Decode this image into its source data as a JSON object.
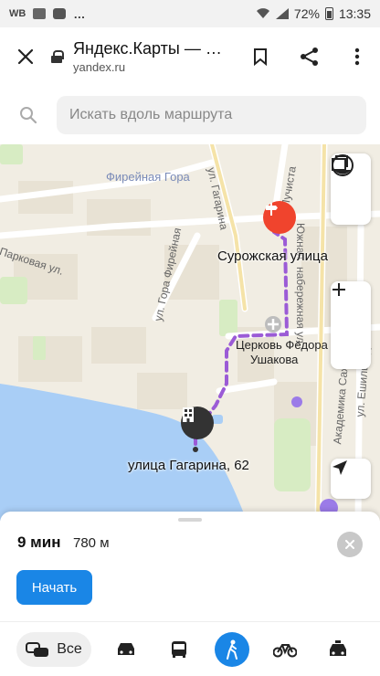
{
  "status_bar": {
    "carrier_label": "WB",
    "battery": "72%",
    "time": "13:35"
  },
  "browser": {
    "title": "Яндекс.Карты — …",
    "url": "yandex.ru"
  },
  "search": {
    "placeholder": "Искать вдоль маршрута"
  },
  "map": {
    "labels": {
      "fireinaya_gora": "Фирейная Гора",
      "gagarina": "ул. Гагарина",
      "luchistaya": "Лучиста",
      "yuzhnaya": "Южная",
      "naberezhnaya": "набережная ул.",
      "parkovaya": "Парковая ул.",
      "gora_fireinaya": "ул. Гора Фирейная",
      "surozhskaya": "Сурожская улица",
      "church_line1": "Церковь Фёдора",
      "church_line2": "Ушакова",
      "akademika": "Академика Сахарова",
      "eshil_ada": "ул. Ешиль-Ада",
      "origin": "улица Гагарина, 62"
    },
    "colors": {
      "land": "#f1ede3",
      "water": "#a9cef6",
      "park": "#d7ecc3",
      "route": "#9b5bd6",
      "destination": "#f0442d",
      "accent": "#1a86e6"
    }
  },
  "route": {
    "time": "9 мин",
    "distance": "780 м",
    "start_label": "Начать"
  },
  "modes": {
    "all_label": "Все",
    "items": [
      "car",
      "bus",
      "walk",
      "bike",
      "taxi"
    ],
    "active": "walk"
  }
}
